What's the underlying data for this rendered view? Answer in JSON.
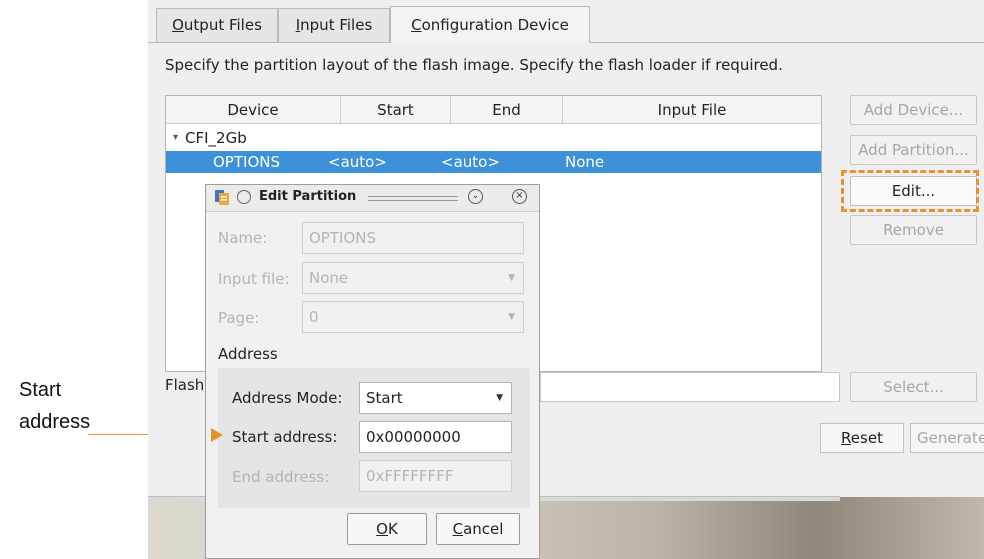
{
  "tabs": [
    {
      "label": "Output Files",
      "underline": "O",
      "rest": "utput Files"
    },
    {
      "label": "Input Files",
      "underline": "I",
      "rest": "nput Files"
    },
    {
      "label": "Configuration Device",
      "underline": "C",
      "rest": "onfiguration Device"
    }
  ],
  "description": "Specify the partition layout of the flash image. Specify the flash loader if required.",
  "table": {
    "headers": [
      "Device",
      "Start",
      "End",
      "Input File"
    ],
    "device": "CFI_2Gb",
    "row": {
      "name": "OPTIONS",
      "start": "<auto>",
      "end": "<auto>",
      "input_file": "None"
    }
  },
  "side_buttons": {
    "add_device": "Add Device...",
    "add_partition": "Add Partition...",
    "edit": "Edit...",
    "remove": "Remove",
    "select": "Select..."
  },
  "flash_label": "Flash",
  "bottom_buttons": {
    "reset_u": "R",
    "reset_rest": "eset",
    "generate": "Generate"
  },
  "dialog": {
    "title": "Edit Partition",
    "name_label": "Name:",
    "name_value": "OPTIONS",
    "input_file_label": "Input file:",
    "input_file_value": "None",
    "page_label": "Page:",
    "page_value": "0",
    "address_section": "Address",
    "address_mode_label": "Address Mode:",
    "address_mode_value": "Start",
    "start_address_label": "Start address:",
    "start_address_value": "0x00000000",
    "end_address_label": "End address:",
    "end_address_value": "0xFFFFFFFF",
    "ok_u": "O",
    "ok_rest": "K",
    "cancel_u": "C",
    "cancel_rest": "ancel"
  },
  "annotation": {
    "line1": "Start",
    "line2": "address"
  },
  "colors": {
    "selection": "#3d91d8",
    "highlight": "#e8922e"
  }
}
